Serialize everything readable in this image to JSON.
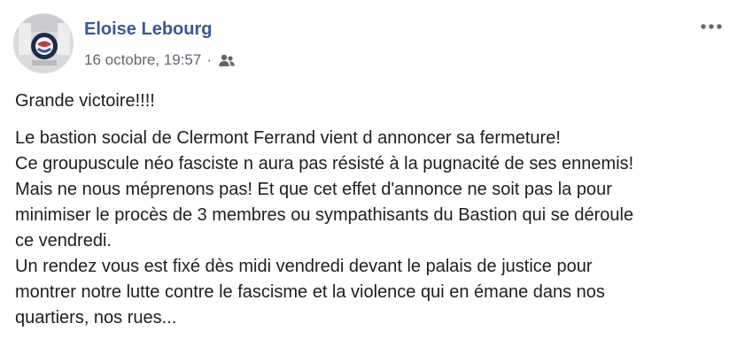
{
  "post": {
    "author": "Eloise Lebourg",
    "timestamp": "16 octobre, 19:57",
    "separator": "·",
    "audience_icon": "friends-icon",
    "more_icon": "more-options-icon",
    "avatar_icon": "avatar-image",
    "first_paragraph": "Grande victoire!!!!",
    "paragraph_lines": [
      "Le bastion social de Clermont Ferrand vient d annoncer sa fermeture!",
      "Ce groupuscule néo fasciste n aura pas résisté à la pugnacité de ses ennemis!",
      "Mais ne nous méprenons pas! Et que cet effet d'annonce ne soit pas la pour",
      "minimiser le procès de 3 membres ou sympathisants du Bastion qui se déroule",
      "ce vendredi.",
      "Un rendez vous est fixé dès midi vendredi devant le palais de justice pour",
      "montrer notre lutte contre le fascisme et la violence qui en émane dans nos",
      "quartiers, nos rues..."
    ]
  },
  "colors": {
    "author_link": "#385898",
    "meta_text": "#616770",
    "body_text": "#1c1e21",
    "background": "#ffffff"
  }
}
